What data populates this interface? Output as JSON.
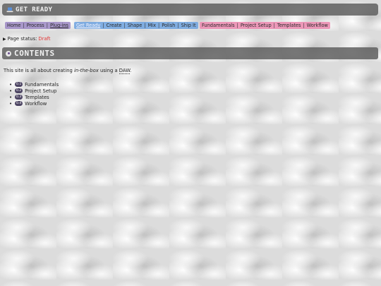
{
  "header": {
    "title": "Get Ready",
    "icon": "laptop-icon"
  },
  "nav": {
    "group1": [
      "Home",
      "Process",
      "Plug-ins"
    ],
    "group2": [
      "Get Ready",
      "Create",
      "Shape",
      "Mix",
      "Polish",
      "Ship It"
    ],
    "group3": [
      "Fundamentals",
      "Project Setup",
      "Templates",
      "Workflow"
    ],
    "separator": "|"
  },
  "status": {
    "label": "Page status:",
    "value": "Draft"
  },
  "contents": {
    "title": "Contents"
  },
  "intro": {
    "before": "This site is all about creating ",
    "emphasis": "in-the-box",
    "middle": " using a ",
    "abbr": "DAW",
    "after": "."
  },
  "toc": [
    {
      "num": "0.1",
      "label": "Fundamentals"
    },
    {
      "num": "0.2",
      "label": "Project Setup"
    },
    {
      "num": "0.3",
      "label": "Templates"
    },
    {
      "num": "0.4",
      "label": "Workflow"
    }
  ],
  "colors": {
    "nav_group1": "#9c88c4",
    "nav_group2": "#74a6e0",
    "nav_group3": "#ec8eb2",
    "status_draft": "#e53838",
    "badge": "#4d4563"
  }
}
